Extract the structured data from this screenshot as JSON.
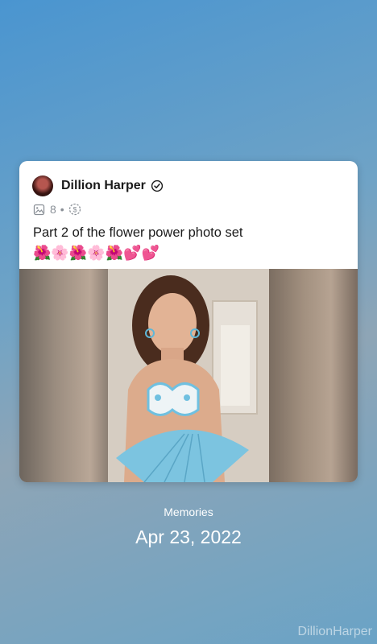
{
  "post": {
    "author": "Dillion Harper",
    "media_count": "8",
    "separator": "•",
    "caption": "Part 2 of the flower power photo set",
    "emojis": "🌺🌸🌺🌸🌺💕💕",
    "icons": {
      "avatar": "avatar",
      "verified": "verified-badge-icon",
      "media": "image-icon",
      "price": "dollar-coin-icon"
    }
  },
  "memories": {
    "label": "Memories",
    "date": "Apr 23, 2022"
  },
  "watermark": "DillionHarper"
}
